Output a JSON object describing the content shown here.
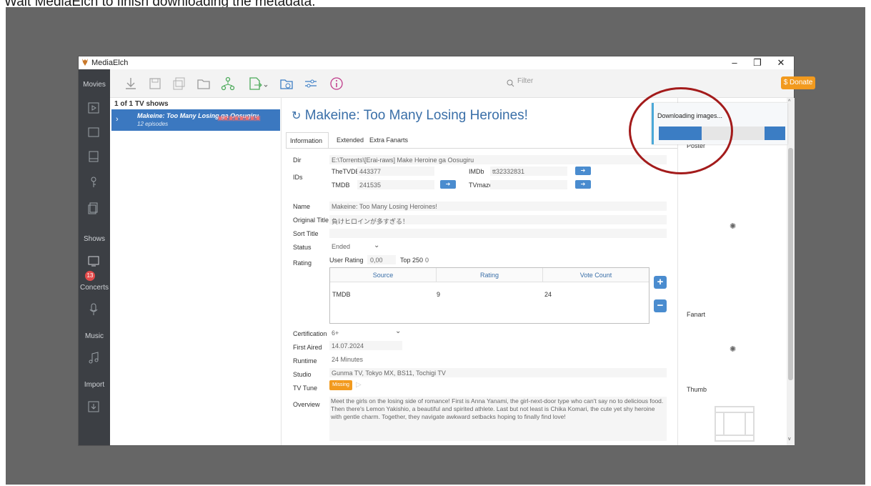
{
  "caption": "Wait MediaElch to finish downloading the metadata.",
  "window": {
    "title": "MediaElch",
    "minimize": "–",
    "restore": "❐",
    "close": "✕"
  },
  "sidebar": {
    "sections": [
      "Movies",
      "Shows",
      "Concerts",
      "Music",
      "Import"
    ],
    "shows_badge": "13"
  },
  "toolbar": {
    "filter_placeholder": "Filter",
    "donate_label": "$ Donate"
  },
  "list": {
    "count": "1 of 1 TV shows",
    "items": [
      {
        "title": "Makeine: Too Many Losing ga Oosugiru",
        "subtitle": "12 episodes"
      }
    ]
  },
  "show": {
    "title": "Makeine: Too Many Losing Heroines!",
    "tabs": [
      "Information",
      "Extended",
      "Extra Fanarts"
    ],
    "dir_label": "Dir",
    "dir": "E:\\Torrents\\[Erai-raws] Make Heroine ga Oosugiru",
    "ids_label": "IDs",
    "thetvdb_label": "TheTVDB",
    "thetvdb": "443377",
    "imdb_label": "IMDb",
    "imdb": "tt32332831",
    "tmdb_label": "TMDB",
    "tmdb": "241535",
    "tvmaze_label": "TVmaze",
    "tvmaze": "",
    "name_label": "Name",
    "name": "Makeine: Too Many Losing Heroines!",
    "original_title_label": "Original Title",
    "original_title": "負けヒロインが多すぎる！",
    "sort_title_label": "Sort Title",
    "sort_title": "",
    "status_label": "Status",
    "status": "Ended",
    "rating_label": "Rating",
    "user_rating_label": "User Rating",
    "user_rating": "0,00",
    "top250_label": "Top 250",
    "top250": "0",
    "ratings_table": {
      "headers": [
        "Source",
        "Rating",
        "Vote Count"
      ],
      "rows": [
        {
          "source": "TMDB",
          "rating": "9",
          "votes": "24"
        }
      ]
    },
    "certification_label": "Certification",
    "certification": "6+",
    "first_aired_label": "First Aired",
    "first_aired": "14.07.2024",
    "runtime_label": "Runtime",
    "runtime": "24 Minutes",
    "studio_label": "Studio",
    "studio": "Gunma TV, Tokyo MX, BS11, Tochigi TV",
    "tv_tune_label": "TV Tune",
    "tv_tune": "Missing",
    "overview_label": "Overview",
    "overview": "Meet the girls on the losing side of romance! First is Anna Yanami, the girl-next-door type who can't say no to delicious food. Then there's Lemon Yakishio, a beautiful and spirited athlete. Last but not least is Chika Komari, the cute yet shy heroine with gentle charm. Together, they navigate awkward setbacks hoping to finally find love!"
  },
  "images": {
    "poster_label": "Poster",
    "fanart_label": "Fanart",
    "thumb_label": "Thumb"
  },
  "download": {
    "text": "Downloading images..."
  },
  "colors": {
    "accent": "#3b78c0",
    "donate": "#f29a1e",
    "highlight_ring": "#a31b1b"
  }
}
